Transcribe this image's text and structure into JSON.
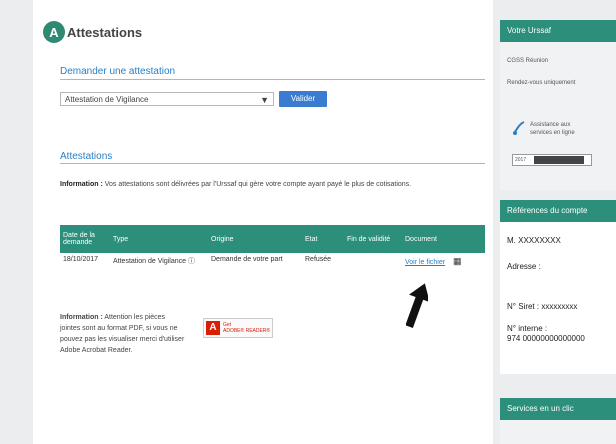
{
  "page": {
    "title": "Attestations",
    "title_initial": "A"
  },
  "request_section": {
    "heading": "Demander une attestation",
    "select_value": "Attestation de Vigilance",
    "select_arrow": "▼",
    "submit_label": "Valider"
  },
  "list_section": {
    "heading": "Attestations",
    "info_label": "Information :",
    "info_text": "Vos attestations sont délivrées par l'Urssaf qui gère votre compte ayant payé le plus de cotisations.",
    "columns": [
      "Date de la demande",
      "Type",
      "Origine",
      "Etat",
      "Fin de validité",
      "Document"
    ],
    "rows": [
      {
        "date": "18/10/2017",
        "type": "Attestation de Vigilance",
        "type_info_icon": "ⓘ",
        "origin": "Demande de votre part",
        "state": "Refusée",
        "validity_end": "",
        "document_link": "Voir le fichier",
        "document_icon": "▦"
      }
    ]
  },
  "bottom_info": {
    "label": "Information :",
    "text": "Attention les pièces jointes sont au format PDF, si vous ne pouvez pas les visualiser merci d'utiliser Adobe Acrobat Reader.",
    "adobe_icon_letter": "A",
    "adobe_line1": "Get",
    "adobe_line2": "ADOBE® READER®"
  },
  "sidebar": {
    "urssaf_header": "Votre Urssaf",
    "urssaf_line1": "CGSS Réunion",
    "urssaf_line2": "Rendez-vous uniquement",
    "assist_line1": "Assistance aux",
    "assist_line2": "services en ligne",
    "banner_left": "2017",
    "references_header": "Références du compte",
    "ref_name": "M. XXXXXXXX",
    "ref_address_label": "Adresse :",
    "ref_siret": "N° Siret : xxxxxxxxx",
    "ref_internal_label": "N° interne :",
    "ref_internal_value": "974 00000000000000",
    "services_header": "Services en un clic"
  },
  "colors": {
    "accent_green": "#2b8f7b",
    "link_blue": "#2a7fc4",
    "button_blue": "#3a7dd0"
  }
}
